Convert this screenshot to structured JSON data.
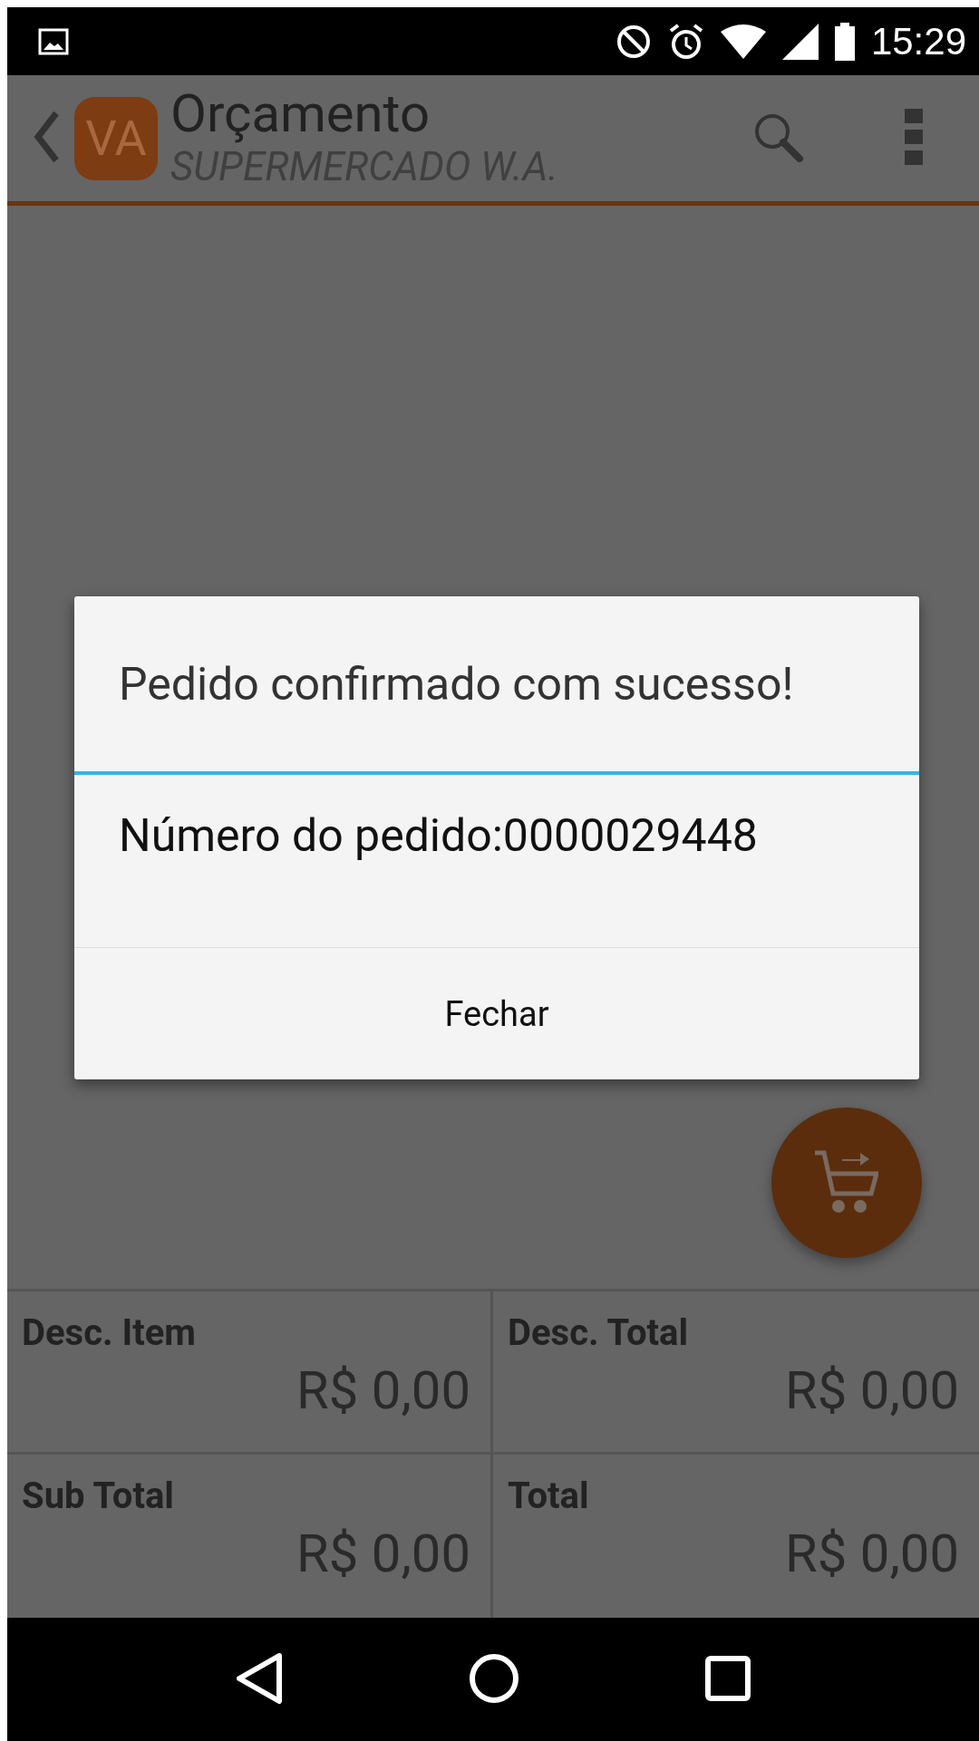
{
  "status_bar": {
    "time": "15:29"
  },
  "app_bar": {
    "avatar": "VA",
    "title": "Orçamento",
    "subtitle": "SUPERMERCADO W.A."
  },
  "dialog": {
    "title": "Pedido confirmado com sucesso!",
    "message": "Número do pedido:0000029448",
    "button": "Fechar"
  },
  "totals": [
    {
      "label": "Desc. Item",
      "value": "R$ 0,00"
    },
    {
      "label": "Desc. Total",
      "value": "R$ 0,00"
    },
    {
      "label": "Sub Total",
      "value": "R$ 0,00"
    },
    {
      "label": "Total",
      "value": "R$ 0,00"
    }
  ]
}
